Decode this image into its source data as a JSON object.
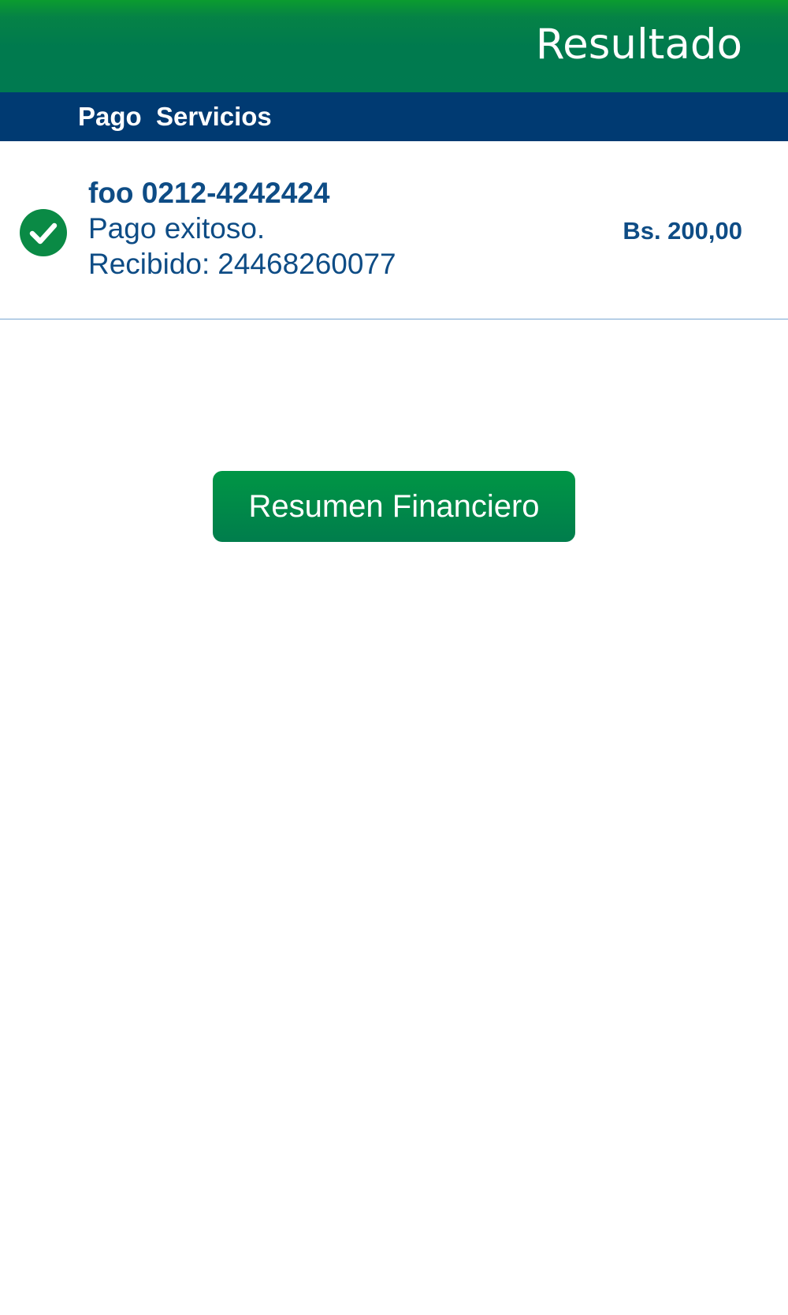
{
  "header": {
    "title": "Resultado"
  },
  "section": {
    "title": "Pago  Servicios"
  },
  "result": {
    "status_icon": "check-circle-icon",
    "name": "foo 0212-4242424",
    "status": "Pago exitoso.",
    "receipt_label": "Recibido:",
    "receipt_number": "24468260077",
    "amount": "Bs. 200,00"
  },
  "actions": {
    "summary_button_label": "Resumen Financiero"
  },
  "colors": {
    "header_green": "#007a4e",
    "section_blue": "#003a72",
    "text_blue": "#0e4c85",
    "success_green": "#0a8a45",
    "divider": "#79a6d2"
  }
}
